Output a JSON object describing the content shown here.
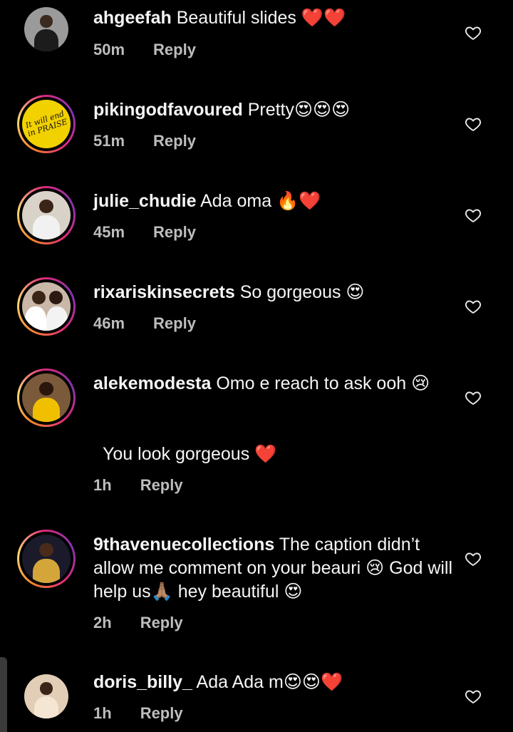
{
  "reply_label": "Reply",
  "comments": [
    {
      "username": "ahgeefah",
      "text": "Beautiful slides ❤️❤️",
      "time": "50m"
    },
    {
      "username": "pikingodfavoured",
      "text": "Pretty😍😍😍",
      "time": "51m",
      "avatar_text": "It will end in PRAISE"
    },
    {
      "username": "julie_chudie",
      "text": "Ada oma 🔥❤️",
      "time": "45m"
    },
    {
      "username": "rixariskinsecrets",
      "text": "So gorgeous 😍",
      "time": "46m"
    },
    {
      "username": "alekemodesta",
      "text": "Omo e reach to ask ooh 😢",
      "time": "1h",
      "extra_text": "You look gorgeous ❤️"
    },
    {
      "username": "9thavenuecollections",
      "text": "The caption didn’t allow me comment on your beauri 😢 God will help us🙏🏽 hey beautiful 😍",
      "time": "2h"
    },
    {
      "username": "doris_billy_",
      "text": "Ada Ada m😍😍❤️",
      "time": "1h"
    }
  ],
  "colors": {
    "background": "#000000",
    "text": "#f5f5f5",
    "muted": "#bdbdbd",
    "story_ring": [
      "#f58529",
      "#dd2a7b",
      "#8134af"
    ]
  },
  "icons": {
    "like": "heart-outline-icon"
  }
}
